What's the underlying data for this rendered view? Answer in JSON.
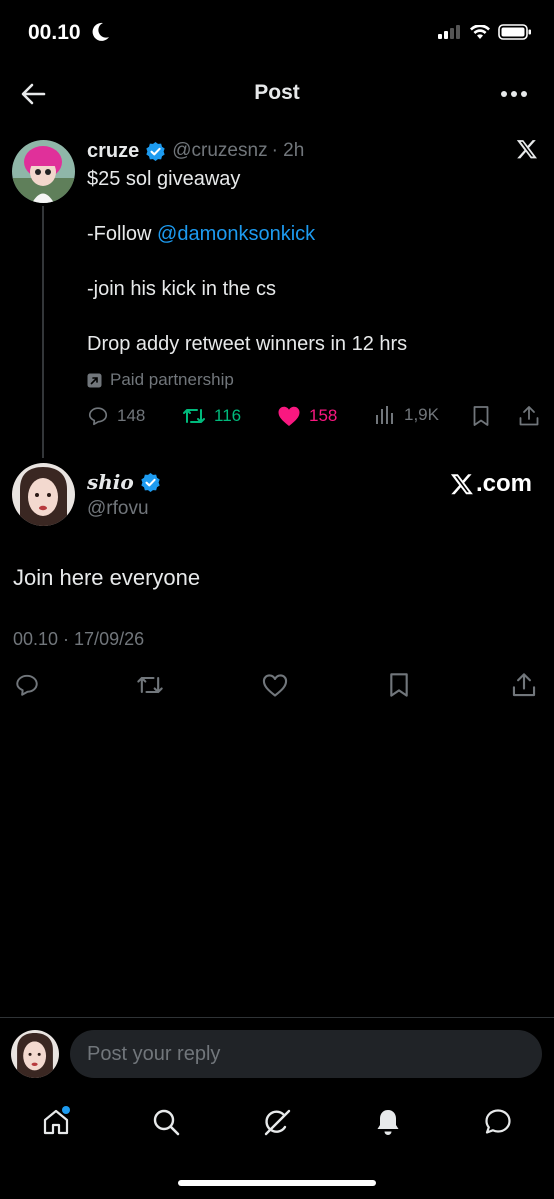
{
  "status_bar": {
    "time": "00.10"
  },
  "header": {
    "title": "Post"
  },
  "parent_tweet": {
    "name": "cruze",
    "handle": "@cruzesnz",
    "time_ago": "· 2h",
    "lines": [
      "$25 sol giveaway",
      "-Follow ",
      "-join his kick in the cs",
      "Drop addy retweet winners in 12 hrs"
    ],
    "mention": "@damonksonkick",
    "paid_label": "Paid partnership",
    "stats": {
      "replies": "148",
      "retweets": "116",
      "likes": "158",
      "views": "1,9K"
    }
  },
  "main_tweet": {
    "name": "shio",
    "handle": "@rfovu",
    "watermark": ".com",
    "text": "Join here everyone",
    "timestamp": "00.10 · 17/09/26"
  },
  "reply": {
    "placeholder": "Post your reply"
  },
  "colors": {
    "accent": "#1d9bf0",
    "retweet": "#00ba7c",
    "like": "#f91880",
    "muted": "#71767b"
  },
  "icons": [
    "back-arrow-icon",
    "more-icon",
    "verified-icon",
    "x-logo-icon",
    "reply-icon",
    "retweet-icon",
    "heart-icon",
    "views-icon",
    "bookmark-icon",
    "share-icon",
    "home-icon",
    "search-icon",
    "grok-icon",
    "bell-icon",
    "messages-icon"
  ]
}
